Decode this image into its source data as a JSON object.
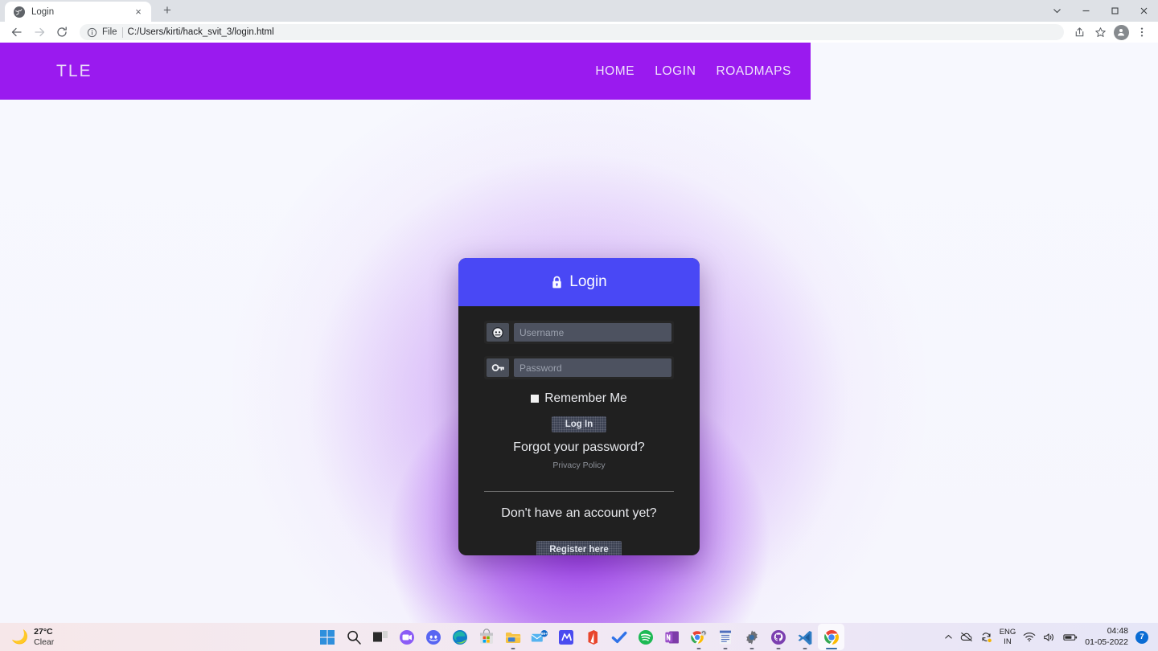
{
  "browser": {
    "tab": {
      "title": "Login",
      "favicon": "globe-icon",
      "close": "×"
    },
    "new_tab_label": "+",
    "window_controls": {
      "minimize": "–",
      "maximize": "❐",
      "close": "✕",
      "chevron": "⌄"
    },
    "omnibox": {
      "scheme_label": "File",
      "url": "C:/Users/kirti/hack_svit_3/login.html",
      "info_icon": "info-circle-icon"
    },
    "nav": {
      "back": "←",
      "forward": "→",
      "reload": "↻"
    },
    "toolbar_icons": [
      "share-icon",
      "star-icon",
      "profile-avatar-icon",
      "three-dot-menu-icon"
    ]
  },
  "site": {
    "brand": "TLE",
    "nav_links": [
      {
        "label": "HOME"
      },
      {
        "label": "LOGIN"
      },
      {
        "label": "ROADMAPS"
      }
    ],
    "navbar_color": "#9a1aef",
    "brand_color": "#e8d8f8"
  },
  "login_card": {
    "header": {
      "title": "Login",
      "icon": "lock-icon",
      "color": "#4948f5"
    },
    "username": {
      "placeholder": "Username",
      "value": "",
      "icon": "user-circle-icon"
    },
    "password": {
      "placeholder": "Password",
      "value": "",
      "icon": "key-icon"
    },
    "remember": {
      "label": "Remember Me",
      "checked": false
    },
    "login_button": "Log In",
    "forgot_link": "Forgot your password?",
    "privacy_link": "Privacy Policy",
    "signup_prompt": "Don't have an account yet?",
    "register_button": "Register here",
    "body_color": "#202020"
  },
  "taskbar": {
    "weather": {
      "temp": "27°C",
      "condition": "Clear",
      "icon": "moon-icon"
    },
    "apps": [
      {
        "name": "start-button",
        "icon": "windows-logo-icon"
      },
      {
        "name": "search",
        "icon": "search-icon"
      },
      {
        "name": "task-view",
        "icon": "task-view-icon"
      },
      {
        "name": "microsoft-teams",
        "icon": "teams-icon"
      },
      {
        "name": "discord",
        "icon": "discord-icon"
      },
      {
        "name": "microsoft-edge",
        "icon": "edge-icon"
      },
      {
        "name": "microsoft-store",
        "icon": "store-icon"
      },
      {
        "name": "file-explorer",
        "icon": "folder-icon"
      },
      {
        "name": "mail",
        "icon": "mail-icon",
        "badge": "99+"
      },
      {
        "name": "messenger",
        "icon": "m-icon"
      },
      {
        "name": "microsoft-office",
        "icon": "office-icon"
      },
      {
        "name": "todo",
        "icon": "check-icon"
      },
      {
        "name": "spotify",
        "icon": "spotify-icon"
      },
      {
        "name": "onenote",
        "icon": "onenote-icon"
      },
      {
        "name": "chrome-pinned",
        "icon": "chrome-icon"
      },
      {
        "name": "notepad",
        "icon": "notepad-icon"
      },
      {
        "name": "settings",
        "icon": "gear-icon"
      },
      {
        "name": "github-desktop",
        "icon": "github-icon"
      },
      {
        "name": "vs-code",
        "icon": "vscode-icon"
      },
      {
        "name": "google-chrome",
        "icon": "chrome-icon"
      }
    ],
    "tray": {
      "overflow": "chevron-up-icon",
      "language": {
        "line1": "ENG",
        "line2": "IN"
      },
      "wifi": "wifi-icon",
      "volume": "volume-icon",
      "battery": "battery-icon",
      "time": "04:48",
      "date": "01-05-2022",
      "notification_count": "7"
    }
  }
}
